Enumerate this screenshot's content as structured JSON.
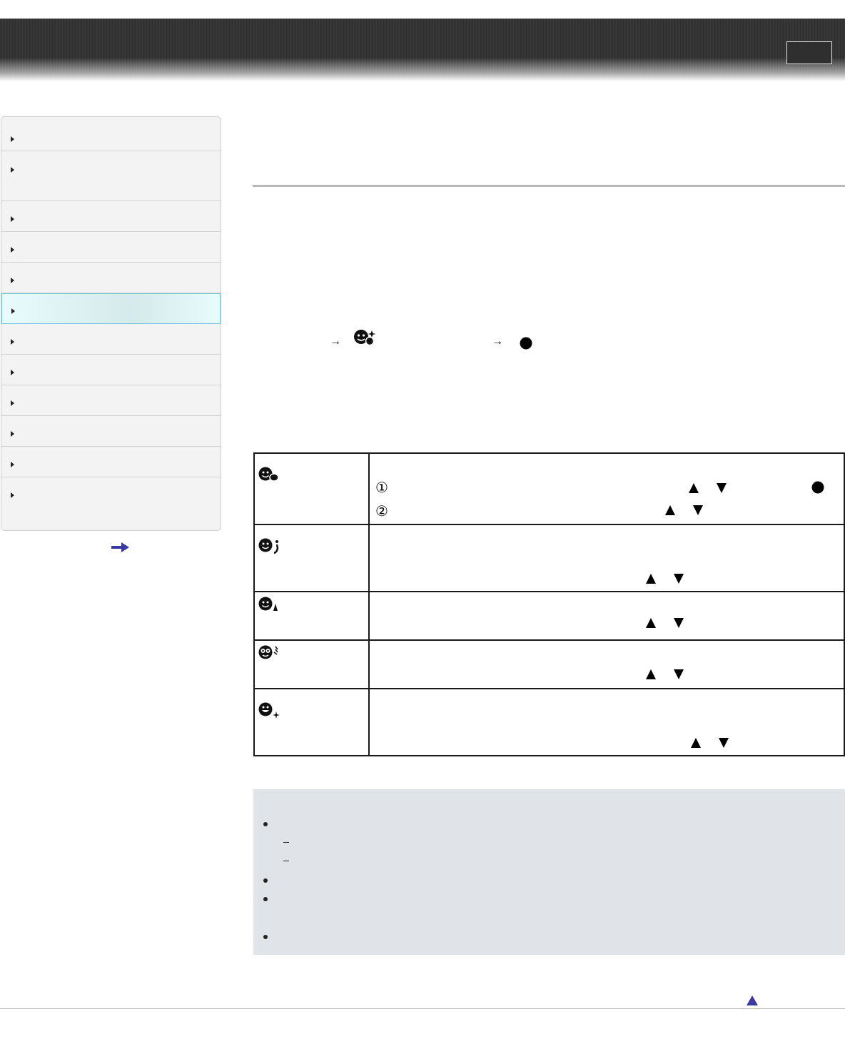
{
  "header": {
    "button_label": ""
  },
  "sidebar": {
    "items": [
      {
        "label": ""
      },
      {
        "label": ""
      },
      {
        "label": ""
      },
      {
        "label": ""
      },
      {
        "label": ""
      },
      {
        "label": ""
      },
      {
        "label": ""
      },
      {
        "label": ""
      },
      {
        "label": ""
      },
      {
        "label": ""
      },
      {
        "label": ""
      },
      {
        "label": ""
      }
    ],
    "active_index": 5,
    "more_icon": "right-arrow-icon"
  },
  "path": {
    "first_arrow": "→",
    "second_arrow": "→",
    "icon": "soft-skin-effect-icon",
    "confirm_icon": "center-button-icon"
  },
  "table": {
    "rows": [
      {
        "icon": "soft-skin-icon",
        "step1_marker": "①",
        "step2_marker": "②",
        "controls": [
          "up-triangle-icon",
          "down-triangle-icon",
          "center-button-icon"
        ]
      },
      {
        "icon": "shine-only-icon",
        "controls": [
          "up-triangle-icon",
          "down-triangle-icon"
        ]
      },
      {
        "icon": "eye-brightener-icon",
        "controls": [
          "up-triangle-icon",
          "down-triangle-icon"
        ]
      },
      {
        "icon": "eye-enlarge-icon",
        "controls": [
          "up-triangle-icon",
          "down-triangle-icon"
        ]
      },
      {
        "icon": "teeth-whitening-icon",
        "controls": [
          "up-triangle-icon",
          "down-triangle-icon"
        ]
      }
    ]
  },
  "notes": {
    "bullets": 4,
    "sub_items": 2
  },
  "footer": {
    "top_icon": "back-to-top-icon"
  },
  "colors": {
    "active_nav": "#dff6f8",
    "active_border": "#74c7d6",
    "note_bg": "#e0e3e8",
    "link": "#3a3aa0"
  }
}
